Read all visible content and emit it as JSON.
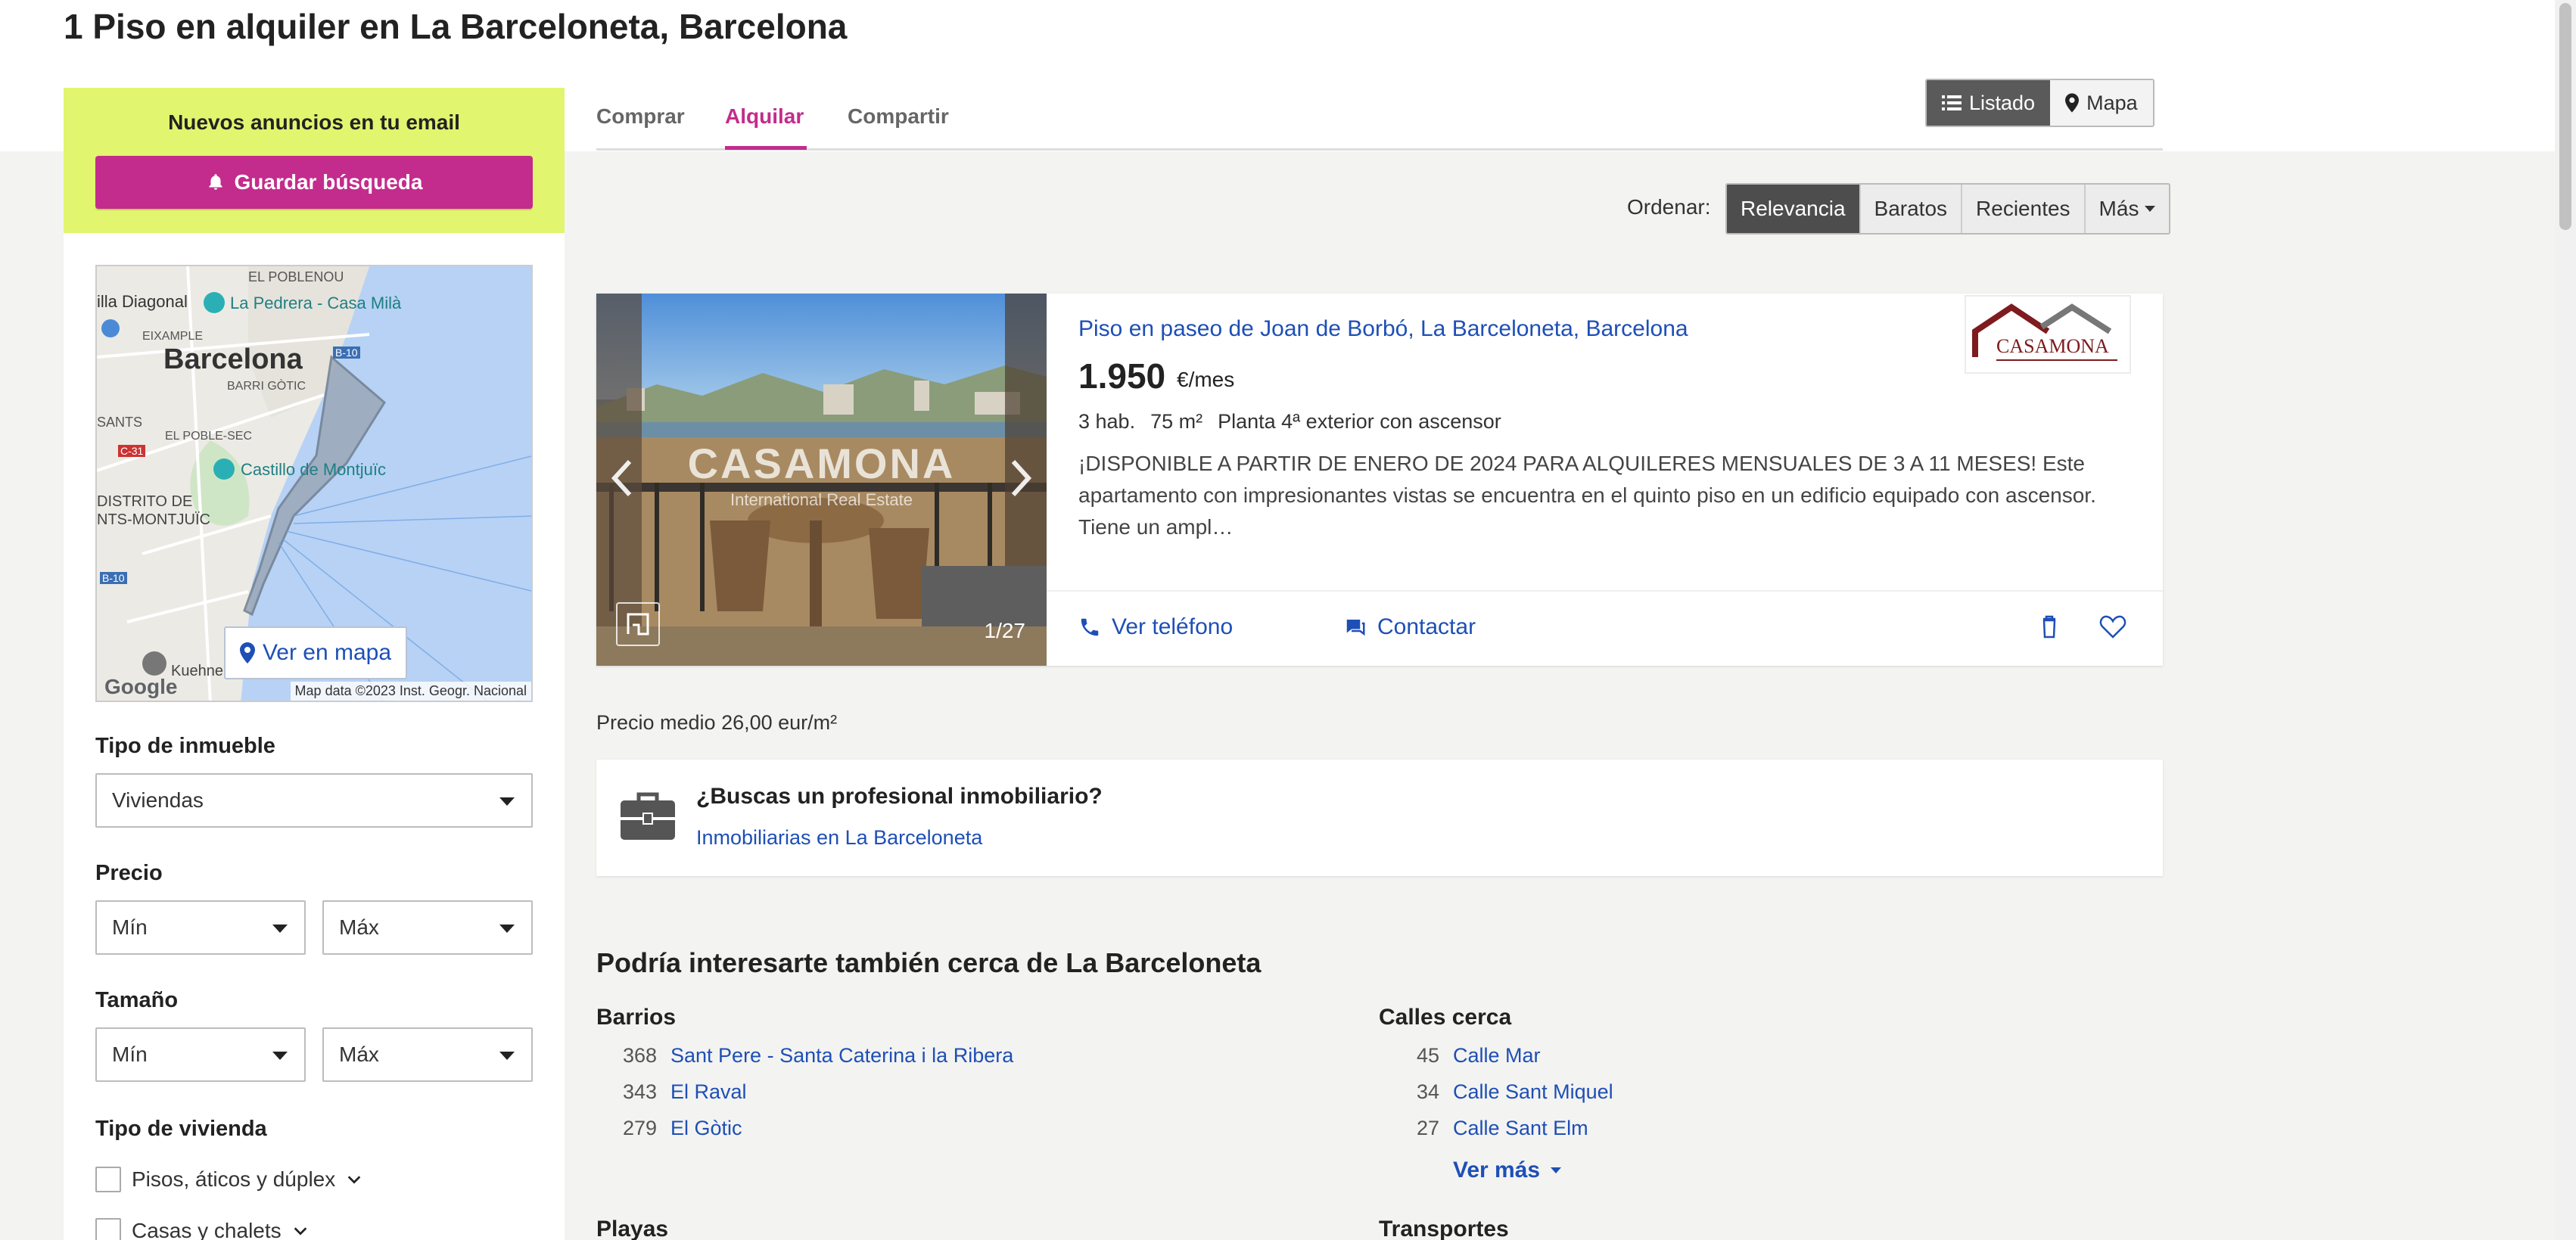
{
  "page": {
    "title": "1 Piso en alquiler en La Barceloneta, Barcelona"
  },
  "sidebar": {
    "alert_title": "Nuevos anuncios en tu email",
    "save_label": "Guardar búsqueda",
    "map": {
      "labels": [
        "EL POBLENOU",
        "illa Diagonal",
        "La Pedrera - Casa Milà",
        "EIXAMPLE",
        "Barcelona",
        "BARRI GÒTIC",
        "B-10",
        "SANTS",
        "C-31",
        "EL POBLE-SEC",
        "Castillo de Montjuïc",
        "DISTRITO DE",
        "NTS-MONTJUÏC",
        "B-10",
        "Kuehne"
      ],
      "button_label": "Ver en mapa",
      "credit": "Map data ©2023 Inst. Geogr. Nacional",
      "google": "Google"
    },
    "property_type": {
      "label": "Tipo de inmueble",
      "value": "Viviendas"
    },
    "price": {
      "label": "Precio",
      "min": "Mín",
      "max": "Máx"
    },
    "size": {
      "label": "Tamaño",
      "min": "Mín",
      "max": "Máx"
    },
    "dwelling_type": {
      "label": "Tipo de vivienda",
      "options": [
        "Pisos, áticos y dúplex",
        "Casas y chalets"
      ]
    }
  },
  "tabs": [
    "Comprar",
    "Alquilar",
    "Compartir"
  ],
  "view_toggle": {
    "list": "Listado",
    "map": "Mapa"
  },
  "sort": {
    "label": "Ordenar:",
    "options": [
      "Relevancia",
      "Baratos",
      "Recientes",
      "Más"
    ]
  },
  "listing": {
    "title": "Piso en paseo de Joan de Borbó, La Barceloneta, Barcelona",
    "price": "1.950",
    "price_unit": "€/mes",
    "features": [
      "3 hab.",
      "75 m²",
      "Planta 4ª exterior con ascensor"
    ],
    "description": "¡DISPONIBLE A PARTIR DE ENERO DE 2024 PARA ALQUILERES MENSUALES DE 3 A 11 MESES! Este apartamento con impresionantes vistas se encuentra en el quinto piso en un edificio equipado con ascensor. Tiene un ampl…",
    "photo_counter": "1/27",
    "watermark": "CASAMONA",
    "watermark_sub": "International Real Estate",
    "logo_text": "CASAMONA",
    "phone_label": "Ver teléfono",
    "contact_label": "Contactar"
  },
  "avg_price": "Precio medio 26,00 eur/m²",
  "pro": {
    "title": "¿Buscas un profesional inmobiliario?",
    "link": "Inmobiliarias en La Barceloneta"
  },
  "nearby": {
    "title": "Podría interesarte también cerca de La Barceloneta",
    "barrios": {
      "heading": "Barrios",
      "items": [
        {
          "count": "368",
          "name": "Sant Pere - Santa Caterina i la Ribera"
        },
        {
          "count": "343",
          "name": "El Raval"
        },
        {
          "count": "279",
          "name": "El Gòtic"
        }
      ]
    },
    "calles": {
      "heading": "Calles cerca",
      "items": [
        {
          "count": "45",
          "name": "Calle Mar"
        },
        {
          "count": "34",
          "name": "Calle Sant Miquel"
        },
        {
          "count": "27",
          "name": "Calle Sant Elm"
        }
      ],
      "more": "Ver más"
    },
    "playas": {
      "heading": "Playas"
    },
    "transportes": {
      "heading": "Transportes"
    }
  },
  "colors": {
    "accent": "#c32c8c",
    "link": "#1e4fb6",
    "alert_bg": "#e1f56e"
  }
}
